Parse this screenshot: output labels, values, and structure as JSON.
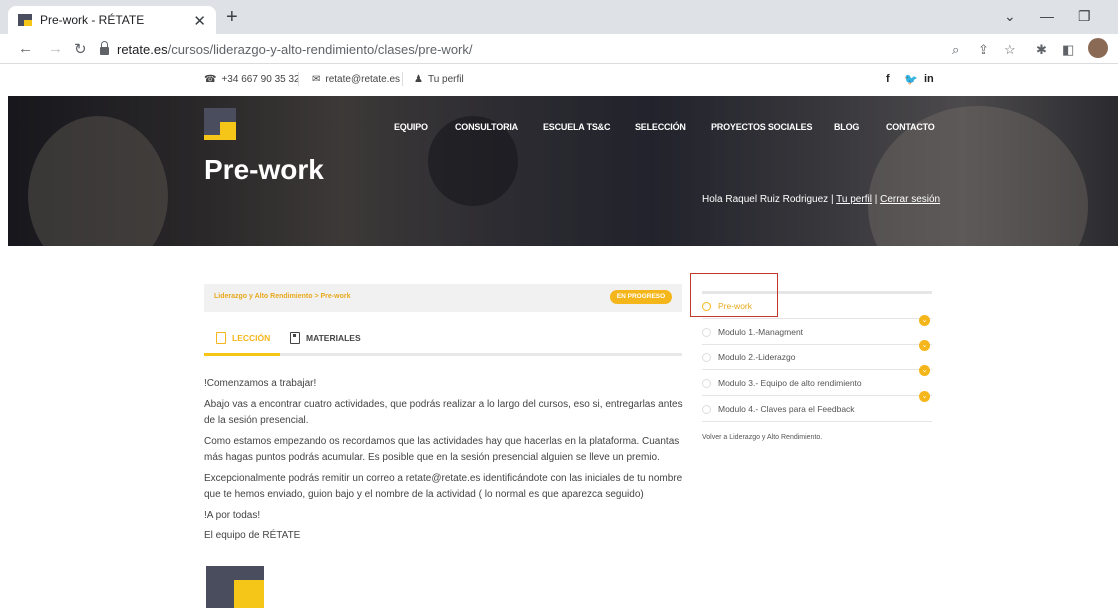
{
  "browser": {
    "tab_title": "Pre-work - RÉTATE",
    "url_host": "retate.es",
    "url_path": "/cursos/liderazgo-y-alto-rendimiento/clases/pre-work/"
  },
  "site": {
    "phone": "+34 667 90 35 32",
    "email": "retate@retate.es",
    "profile": "Tu perfil",
    "social": [
      "f",
      "y",
      "in"
    ]
  },
  "nav": {
    "items": [
      "EQUIPO",
      "CONSULTORIA",
      "ESCUELA TS&C",
      "SELECCIÓN",
      "PROYECTOS SOCIALES",
      "BLOG",
      "CONTACTO"
    ]
  },
  "hero": {
    "title": "Pre-work",
    "greeting": "Hola Raquel Ruiz Rodriguez |",
    "profile_link": "Tu perfil",
    "logout_link": "Cerrar sesión"
  },
  "lesson": {
    "breadcrumb": "Liderazgo y Alto Rendimiento > Pre-work",
    "status": "EN PROGRESO",
    "tab_lesson": "LECCIÓN",
    "tab_materials": "MATERIALES",
    "paragraphs": [
      "!Comenzamos a trabajar!",
      "Abajo vas a encontrar cuatro actividades, que podrás realizar a lo largo del cursos, eso si, entregarlas antes de la sesión presencial.",
      "Como estamos empezando os recordamos que las actividades hay que hacerlas en la plataforma. Cuantas más hagas puntos podrás acumular. Es posible que en la sesión presencial alguien se lleve un premio.",
      "Excepcionalmente podrás remitir un correo a retate@retate.es identificándote con las iniciales de tu nombre que te hemos enviado, guion bajo y el nombre de la actividad ( lo normal es que aparezca seguido)",
      "!A por todas!",
      "El equipo de RÉTATE"
    ]
  },
  "sidebar": {
    "modules": [
      "Pre-work",
      "Modulo 1.-Managment",
      "Modulo 2.-Liderazgo",
      "Modulo 3.- Equipo de alto rendimiento",
      "Modulo 4.- Claves para el Feedback"
    ],
    "back": "Volver a Liderazgo y Alto Rendimiento."
  },
  "colors": {
    "accent": "#f5b61b",
    "brand_dark": "#4a4d5e",
    "highlight": "#c0392b"
  }
}
